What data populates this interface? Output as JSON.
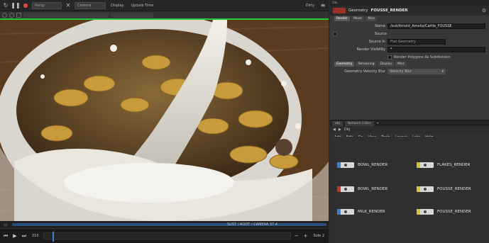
{
  "viewport_toolbar": {
    "camera_menu": "Persp",
    "view_menu": "Camera",
    "display_label": "Display",
    "render_label": "Update Time",
    "shading_label": "Dirty"
  },
  "viewport": {
    "hud_text": "",
    "status_text": "SUST / ROOT / CAMERA  37.4"
  },
  "timeline": {
    "frame": "210",
    "play_label": "Solo 2"
  },
  "param_panel": {
    "tabs": [
      "Obj"
    ],
    "node_type": "Geometry",
    "node_name": "FOUSSE_RENDER",
    "sub_tabs": [
      "Render",
      "Mixer",
      "Misc"
    ],
    "rows": [
      {
        "label": "Name",
        "value": "/out/Arnold_Amelia/Cattle_FOUSSE"
      },
      {
        "label": "Source",
        "value": ""
      },
      {
        "label": "Source In",
        "value": "Flat Geometry"
      },
      {
        "label": "Render Visibility",
        "value": "*"
      },
      {
        "label": "",
        "value": "Render Polygons As Subdivision"
      }
    ],
    "sub_tabs2": [
      "Geometry",
      "Rendering",
      "Display",
      "Misc"
    ],
    "geo_velocity_label": "Geometry Velocity Blur",
    "geo_velocity_value": "Velocity Blur"
  },
  "network": {
    "tabs": [
      "obj",
      "Network Editor"
    ],
    "path": "Obj",
    "menu": [
      "Add",
      "Edit",
      "Go",
      "View",
      "Tools",
      "Layout",
      "Labs",
      "Help"
    ],
    "nodes": [
      {
        "name": "BOWL_RENDER",
        "flag": "blue"
      },
      {
        "name": "FLAKES_RENDER",
        "flag": "yellow"
      },
      {
        "name": "BOWL_RENDER",
        "flag": "red"
      },
      {
        "name": "FOUSSE_RENDER",
        "flag": "yellow"
      },
      {
        "name": "MILK_RENDER",
        "flag": "blue"
      },
      {
        "name": "FOUSSE_RENDER",
        "flag": "yellow"
      }
    ]
  }
}
